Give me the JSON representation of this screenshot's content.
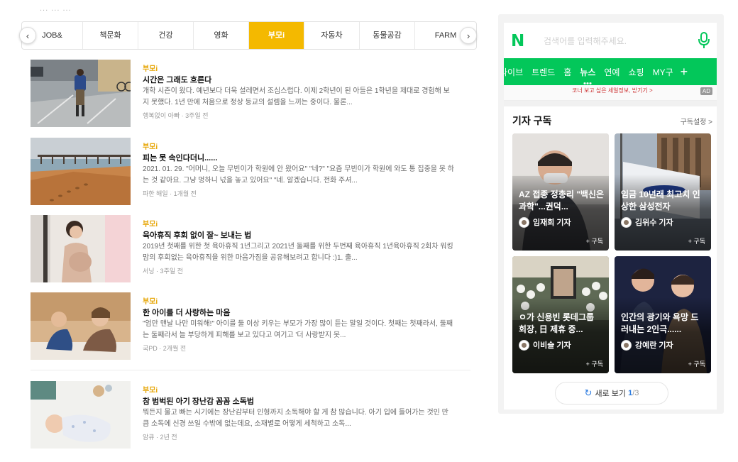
{
  "top_faded_text": "... ... ...",
  "tabs": {
    "prev_icon": "chevron-left",
    "next_icon": "chevron-right",
    "items": [
      {
        "label": "JOB&"
      },
      {
        "label": "책문화"
      },
      {
        "label": "건강"
      },
      {
        "label": "영화"
      },
      {
        "label": "부모i"
      },
      {
        "label": "자동차"
      },
      {
        "label": "동물공감"
      },
      {
        "label": "FARM"
      }
    ],
    "active_index": 4
  },
  "articles": [
    {
      "category": "부모i",
      "title": "시간은 그래도 흐른다",
      "desc": "개학 시즌이 왔다. 예년보다 더욱 설레면서 조심스럽다. 이제 2학년이 된 아들은 1학년을 제대로 경험해 보지 못했다. 1년 만에 처음으로 정상 등교의 설렘을 느끼는 중이다. 물론...",
      "meta": "행복없이 아빠 · 3주일 전"
    },
    {
      "category": "부모i",
      "title": "피는 못 속인다더니......",
      "desc": "2021. 01. 29. \"어머니, 오늘 무빈이가 학원에 안 왔어요\" \"네?\" \"요즘 무빈이가 학원에 와도 통 집중을 못 하는 것 같아요. 그냥 멍하니 넋을 놓고 있어요\" \"네. 알겠습니다. 전화 주셔...",
      "meta": "파한 해일 · 1개월 전"
    },
    {
      "category": "부모i",
      "title": "육아휴직 후회 없이 잘~ 보내는 법",
      "desc": "2019년 첫째를 위한 첫 육아휴직 1년그리고 2021년 둘째를 위한 두번째 육아휴직 1년육아휴직 2회차 워킹맘의 후회없는 육아휴직을 위한 마음가짐을 공유해보려고 합니다 :)1. 출...",
      "meta": "서닝 · 3주일 전"
    },
    {
      "category": "부모i",
      "title": "한 아이를 더 사랑하는 마음",
      "desc": "\"엄만 맨날 나만 미워해!\" 아이를 둘 이상 키우는 부모가 가장 많이 듣는 말일 것이다. 첫째는 첫째라서, 둘째는 둘째라서 늘 부당하게 피해를 보고 있다고 여기고 '더 사랑받지 못...",
      "meta": "국PD · 2개월 전"
    },
    {
      "category": "부모i",
      "title": "참 범벅된 아기 장난감 꼼꼼 소독법",
      "desc": "뭐든지 물고 빠는 시기에는 장난감부터 인형까지 소독해야 할 게 참 많습니다. 아기 입에 들어가는 것인 만큼 소독에 신경 쓰일 수밖에 없는데요, 소재별로 어떻게 세척하고 소독...",
      "meta": "암큐 · 2년 전"
    }
  ],
  "mobile": {
    "logo": "N",
    "search_placeholder": "검색어를 입력해주세요.",
    "nav": [
      "라이브",
      "트렌드",
      "홈",
      "뉴스",
      "연예",
      "쇼핑",
      "MY구"
    ],
    "nav_active_index": 3,
    "nav_plus": "+",
    "ad_text": "코너 보고 싶은 세일정보, 받기기 >",
    "ad_badge": "AD",
    "section_title": "기자 구독",
    "section_setting": "구독설정 >",
    "cards": [
      {
        "title": "AZ 접종 정총리 \"백신은 과학\"...권덕...",
        "reporter": "임재희 기자",
        "follow": "+ 구독"
      },
      {
        "title": "임금 10년래 최고치 인상한 삼성전자",
        "reporter": "김위수 기자",
        "follow": "+ 구독"
      },
      {
        "title": "ㅇ가 신용빈 롯데그룹 회장, 日 제휴 중...",
        "reporter": "이비슬 기자",
        "follow": "+ 구독"
      },
      {
        "title": "인간의 광기와 욕망 드러내는 2인극......",
        "reporter": "강예란 기자",
        "follow": "+ 구독"
      }
    ],
    "more_label": "새로 보기",
    "more_page_current": "1",
    "more_page_total": "/3",
    "colors": {
      "brand_green": "#03c75a",
      "tab_active": "#f4b900",
      "category": "#e6a400"
    }
  }
}
